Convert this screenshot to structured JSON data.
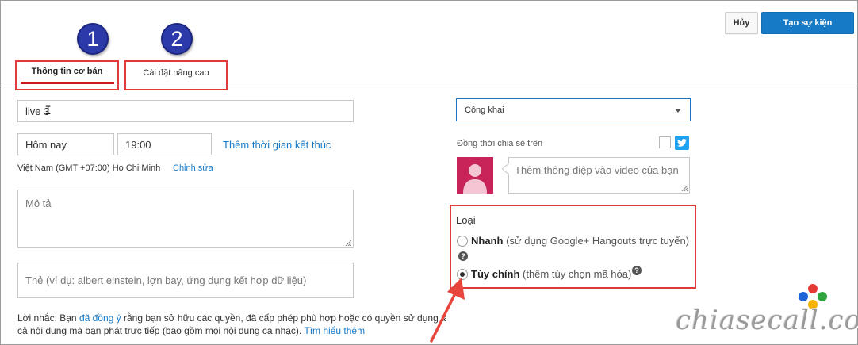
{
  "header": {
    "cancel_label": "Hủy",
    "create_label": "Tạo sự kiện"
  },
  "annotations": {
    "step1": "1",
    "step2": "2"
  },
  "tabs": [
    {
      "label": "Thông tin cơ bản",
      "active": true
    },
    {
      "label": "Cài đặt nâng cao",
      "active": false
    }
  ],
  "form": {
    "title_value": "live 3",
    "date_value": "Hôm nay",
    "time_value": "19:00",
    "add_end_time_link": "Thêm thời gian kết thúc",
    "timezone": "Việt Nam (GMT +07:00) Ho Chi Minh",
    "edit_link": "Chỉnh sửa",
    "description_placeholder": "Mô tả",
    "tags_placeholder": "Thẻ (ví dụ: albert einstein, lợn bay, ứng dụng kết hợp dữ liệu)",
    "notice_prefix": "Lời nhắc: Bạn",
    "notice_link1": "đã đồng ý",
    "notice_middle": "rằng bạn sở hữu các quyền, đã cấp phép phù hợp hoặc có quyền sử dụng tất",
    "notice_line2": "cả nội dung mà bạn phát trực tiếp (bao gồm mọi nội dung ca nhạc).",
    "notice_link2": "Tìm hiểu thêm"
  },
  "privacy": {
    "selected": "Công khai"
  },
  "share": {
    "label": "Đồng thời chia sẻ trên",
    "message_placeholder": "Thêm thông điệp vào video của bạn"
  },
  "type": {
    "heading": "Loại",
    "options": [
      {
        "name": "Nhanh",
        "desc": "(sử dụng Google+ Hangouts trực tuyến)",
        "selected": false
      },
      {
        "name": "Tùy chỉnh",
        "desc": "(thêm tùy chọn mã hóa)",
        "selected": true
      }
    ],
    "help_glyph": "?"
  },
  "watermark": {
    "text": "chiasecall.com",
    "dot_colors": [
      "#e53935",
      "#1e63d6",
      "#2fa33d",
      "#f4b400"
    ]
  },
  "colors": {
    "accent_blue": "#167ac6",
    "highlight_red": "#e03a3a",
    "circle_blue": "#2b3aa8",
    "avatar_bg": "#c8245a",
    "twitter": "#1da1f2"
  }
}
